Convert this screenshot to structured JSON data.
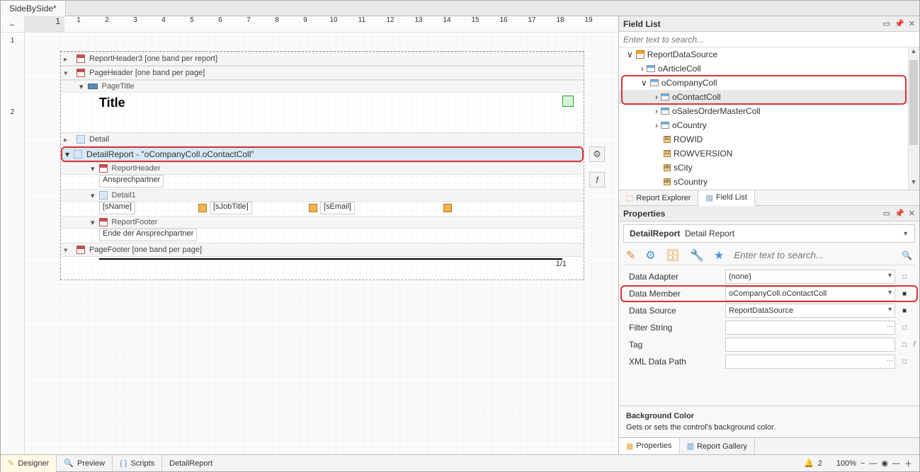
{
  "tab_title": "SideBySide*",
  "ruler": {
    "shade": "1",
    "marks": [
      "1",
      "2",
      "3",
      "4",
      "5",
      "6",
      "7",
      "8",
      "9",
      "10",
      "11",
      "12",
      "13",
      "14",
      "15",
      "16",
      "17",
      "18",
      "19"
    ]
  },
  "vruler": [
    "1",
    "2"
  ],
  "bands": {
    "report_header3": "ReportHeader3 [one band per report]",
    "page_header": "PageHeader [one band per page]",
    "page_title": "PageTitle",
    "title_text": "Title",
    "detail": "Detail",
    "detail_report": "DetailReport - \"oCompanyColl.oContactColl\"",
    "report_header": "ReportHeader",
    "ansprechpartner": "Ansprechpartner",
    "detail1": "Detail1",
    "fields": {
      "sName": "[sName]",
      "sJobTitle": "[sJobTitle]",
      "sEmail": "[sEmail]"
    },
    "report_footer": "ReportFooter",
    "ende": "Ende der Ansprechpartner",
    "page_footer": "PageFooter [one band per page]",
    "page_num": "1/1"
  },
  "field_list": {
    "title": "Field List",
    "search_placeholder": "Enter text to search...",
    "items": [
      {
        "lvl": 0,
        "exp": "v",
        "icon": "report",
        "label": "ReportDataSource"
      },
      {
        "lvl": 1,
        "exp": ">",
        "icon": "table",
        "label": "oArticleColl"
      },
      {
        "lvl": 1,
        "exp": "v",
        "icon": "table",
        "label": "oCompanyColl",
        "hl": true
      },
      {
        "lvl": 2,
        "exp": ">",
        "icon": "table",
        "label": "oContactColl",
        "sel": true
      },
      {
        "lvl": 2,
        "exp": ">",
        "icon": "table",
        "label": "oSalesOrderMasterColl"
      },
      {
        "lvl": 2,
        "exp": ">",
        "icon": "table",
        "label": "oCountry"
      },
      {
        "lvl": 2,
        "exp": "",
        "icon": "col",
        "label": "ROWID",
        "badge": "ID"
      },
      {
        "lvl": 2,
        "exp": "",
        "icon": "col",
        "label": "ROWVERSION",
        "badge": "12"
      },
      {
        "lvl": 2,
        "exp": "",
        "icon": "col",
        "label": "sCity",
        "badge": "ab"
      },
      {
        "lvl": 2,
        "exp": "",
        "icon": "col",
        "label": "sCountry",
        "badge": "ab"
      }
    ],
    "tabs": {
      "explorer": "Report Explorer",
      "fieldlist": "Field List"
    }
  },
  "properties": {
    "title": "Properties",
    "selector": {
      "name": "DetailReport",
      "type": "Detail Report"
    },
    "search_placeholder": "Enter text to search...",
    "rows": [
      {
        "label": "Data Adapter",
        "value": "(none)",
        "dd": true,
        "mark": "□"
      },
      {
        "label": "Data Member",
        "value": "oCompanyColl.oContactColl",
        "dd": true,
        "mark": "■",
        "hl": true
      },
      {
        "label": "Data Source",
        "value": "ReportDataSource",
        "dd": true,
        "mark": "■"
      },
      {
        "label": "Filter String",
        "value": "",
        "dd": false,
        "dots": true,
        "mark": "□"
      },
      {
        "label": "Tag",
        "value": "",
        "dd": false,
        "mark": "□",
        "fx": true
      },
      {
        "label": "XML Data Path",
        "value": "",
        "dd": false,
        "dots": true,
        "mark": "□"
      }
    ],
    "desc": {
      "title": "Background Color",
      "text": "Gets or sets the control's background color."
    }
  },
  "bottom": {
    "designer": "Designer",
    "preview": "Preview",
    "scripts": "Scripts",
    "crumb": "DetailReport",
    "notif": "2",
    "zoom": "100%",
    "properties": "Properties",
    "gallery": "Report Gallery"
  }
}
